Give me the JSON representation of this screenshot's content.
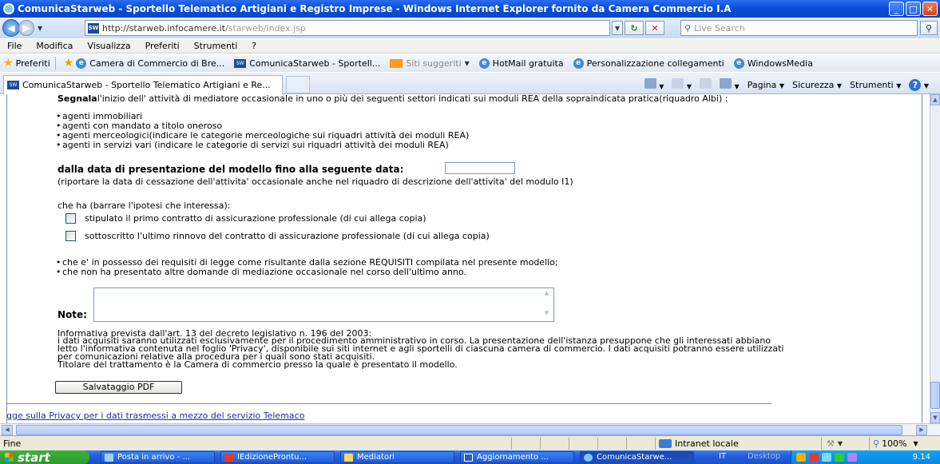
{
  "window": {
    "title": "ComunicaStarweb - Sportello Telematico Artigiani e Registro Imprese - Windows Internet Explorer fornito da Camera Commercio I.A"
  },
  "address_bar": {
    "url_host": "http://starweb.infocamere.it",
    "url_path": "/starweb/index.jsp",
    "search_placeholder": "Live Search"
  },
  "menu": [
    "File",
    "Modifica",
    "Visualizza",
    "Preferiti",
    "Strumenti",
    "?"
  ],
  "favorites_bar": {
    "label": "Preferiti",
    "items": [
      {
        "label": "Camera di Commercio di Bre...",
        "icon": "ie-icon"
      },
      {
        "label": "ComunicaStarweb - Sportell...",
        "icon": "starweb-icon"
      },
      {
        "label": "Siti suggeriti",
        "icon": "suggested-sites-icon",
        "muted": true
      },
      {
        "label": "HotMail gratuita",
        "icon": "ie-icon"
      },
      {
        "label": "Personalizzazione collegamenti",
        "icon": "ie-icon"
      },
      {
        "label": "WindowsMedia",
        "icon": "ie-icon"
      }
    ]
  },
  "tab": {
    "label": "ComunicaStarweb - Sportello Telematico Artigiani e Re..."
  },
  "command_bar": {
    "pagina": "Pagina",
    "sicurezza": "Sicurezza",
    "strumenti": "Strumenti"
  },
  "page": {
    "segnala_bold": "Segnala",
    "segnala_rest": "l'inizio dell' attività di mediatore occasionale in uno o più dei seguenti settori indicati sui moduli REA della sopraindicata pratica(riquadro Albi) :",
    "sectors": [
      "agenti immobiliari",
      "agenti con mandato a titolo oneroso",
      "agenti merceologici(indicare le categorie merceologiche sui riquadri attività dei moduli REA)",
      "agenti in servizi vari (indicare le categorie di servizi sui riquadri attività dei moduli REA)"
    ],
    "date_label": "dalla data di presentazione del modello fino alla seguente data",
    "date_colon": ":",
    "date_value": "",
    "date_note": "(riportare la data di cessazione dell'attivita' occasionale anche nel riquadro di descrizione dell'attivita' del modulo I1)",
    "che_ha": "che ha (barrare l'ipotesi che interessa):",
    "option1": "stipulato il primo contratto di assicurazione professionale (di cui allega copia)",
    "option2": "sottoscritto l'ultimo rinnovo del contratto di assicurazione professionale (di cui allega copia)",
    "requisiti": [
      "che e' in possesso dei requisiti di legge come risultante dalla sezione REQUISITI compilata nel presente modello;",
      "che non ha presentato altre domande di mediazione occasionale nel corso dell'ultimo anno."
    ],
    "note_label": "Note:",
    "note_value": "",
    "informativa": [
      "Informativa prevista dall'art. 13 del decreto legislativo n. 196 del 2003:",
      "i dati acquisiti saranno utilizzati esclusivamente per il procedimento amministrativo in corso. La presentazione dell'istanza presuppone che gli interessati abbiano",
      "letto l'informativa contenuta nel foglio 'Privacy', disponibile sui siti internet e agli sportelli di ciascuna camera di commercio. I dati acquisiti potranno essere utilizzati",
      "per comunicazioni relative alla procedura per i quali sono stati acquisiti.",
      "Titolare del trattamento è la Camera di commercio presso la quale è presentato il modello."
    ],
    "pdf_button": "Salvataggio PDF",
    "privacy_link": "gge sulla Privacy per i dati trasmessi a mezzo del servizio Telemaco"
  },
  "status_bar": {
    "status": "Fine",
    "zone": "Intranet locale",
    "zoom": "100%"
  },
  "taskbar": {
    "start": "start",
    "tasks": [
      {
        "label": "Posta in arrivo - ...",
        "icon": "outlook-icon"
      },
      {
        "label": "IEdizioneProntu...",
        "icon": "pdf-icon"
      },
      {
        "label": "Mediatori",
        "icon": "folder-icon"
      },
      {
        "label": "Aggiornamento ...",
        "icon": "word-icon"
      },
      {
        "label": "ComunicaStarwe...",
        "icon": "ie-icon",
        "active": true
      }
    ],
    "lang": "IT",
    "desktop": "Desktop",
    "clock": "9.14"
  },
  "colors": {
    "titlebar": "#0a4fd6",
    "link": "#1a2ea8",
    "taskbar": "#245edb",
    "start": "#3db13d"
  }
}
